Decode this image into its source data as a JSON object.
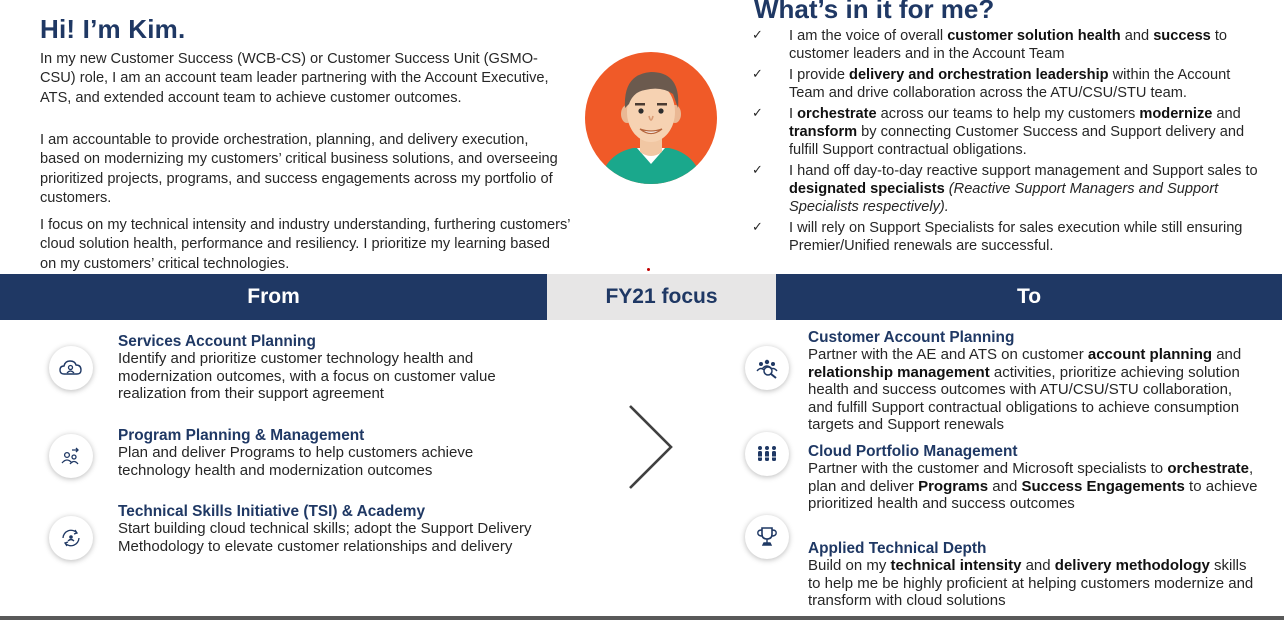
{
  "intro": {
    "greeting": "Hi! I’m Kim.",
    "p1": "In my new Customer Success (WCB-CS) or Customer Success Unit (GSMO-CSU) role, I am an account team leader partnering with the Account Executive, ATS, and extended account team to achieve customer outcomes.",
    "p2": "I am accountable to provide orchestration, planning, and delivery execution, based on modernizing my customers’ critical business solutions, and overseeing prioritized projects, programs, and success engagements across my portfolio of customers.",
    "p3": "I focus on my technical intensity and industry understanding, furthering customers’ cloud solution health, performance and resiliency. I prioritize my learning based on my customers’ critical technologies."
  },
  "avatar": {
    "icon": "person-avatar-icon",
    "bg_color": "#f05a28"
  },
  "benefits": {
    "title": "What’s in it for me?",
    "mark": "✓",
    "items": [
      {
        "a": "I am the voice of overall ",
        "b": "customer solution health",
        "c": " and ",
        "d": "success",
        "e": " to customer leaders and in the Account Team"
      },
      {
        "a": "I provide ",
        "b": "delivery and orchestration leadership",
        "c": " within the Account Team and drive collaboration across the ATU/CSU/STU team."
      },
      {
        "a": "I ",
        "b": "orchestrate",
        "c": " across our teams to help my customers ",
        "d": "modernize",
        "e": " and ",
        "f": "transform",
        "g": " by connecting Customer Success and Support delivery and fulfill Support contractual obligations."
      },
      {
        "a": "I hand off day-to-day reactive support management and Support sales to ",
        "b": "designated specialists",
        "c": " (Reactive Support Managers and Support Specialists respectively)."
      },
      {
        "a": "I will rely on Support Specialists for sales execution while still ensuring Premier/Unified renewals are successful."
      }
    ]
  },
  "band": {
    "from": "From",
    "mid": "FY21 focus",
    "to": "To"
  },
  "from_items": [
    {
      "icon": "cloud-user-icon",
      "title": "Services Account Planning",
      "body": "Identify and prioritize customer technology health and modernization outcomes, with a focus on customer value realization from their support agreement"
    },
    {
      "icon": "people-arrow-icon",
      "title": "Program Planning & Management",
      "body": "Plan and deliver Programs to help customers achieve technology health and modernization outcomes"
    },
    {
      "icon": "skills-cycle-icon",
      "title": "Technical Skills Initiative (TSI) & Academy",
      "body": "Start building cloud technical skills; adopt the Support Delivery Methodology to elevate customer relationships and delivery"
    }
  ],
  "to_items": [
    {
      "icon": "team-search-icon",
      "title": "Customer Account Planning",
      "t1": "Partner with the AE and ATS on customer ",
      "b1": "account planning",
      "t2": " and  ",
      "b2": "relationship management",
      "t3": " activities, prioritize achieving solution health and success outcomes with ATU/CSU/STU collaboration, and fulfill Support contractual obligations to achieve consumption targets and Support renewals"
    },
    {
      "icon": "group-icon",
      "title": "Cloud Portfolio Management",
      "t1": "Partner with the customer and Microsoft specialists to ",
      "b1": "orchestrate",
      "t2": ", plan and deliver ",
      "b2": "Programs",
      "t3": " and ",
      "b3": "Success Engagements",
      "t4": " to achieve prioritized health and success outcomes"
    },
    {
      "icon": "trophy-icon",
      "title": "Applied Technical Depth",
      "t1": "Build on my ",
      "b1": "technical intensity",
      "t2": " and ",
      "b2": "delivery methodology",
      "t3": " skills to help me be highly proficient at helping customers modernize and transform with cloud solutions"
    }
  ],
  "chevron_icon": "chevron-right-icon",
  "colors": {
    "navy": "#1f3864",
    "band_gray": "#e7e6e6",
    "text": "#262626"
  }
}
